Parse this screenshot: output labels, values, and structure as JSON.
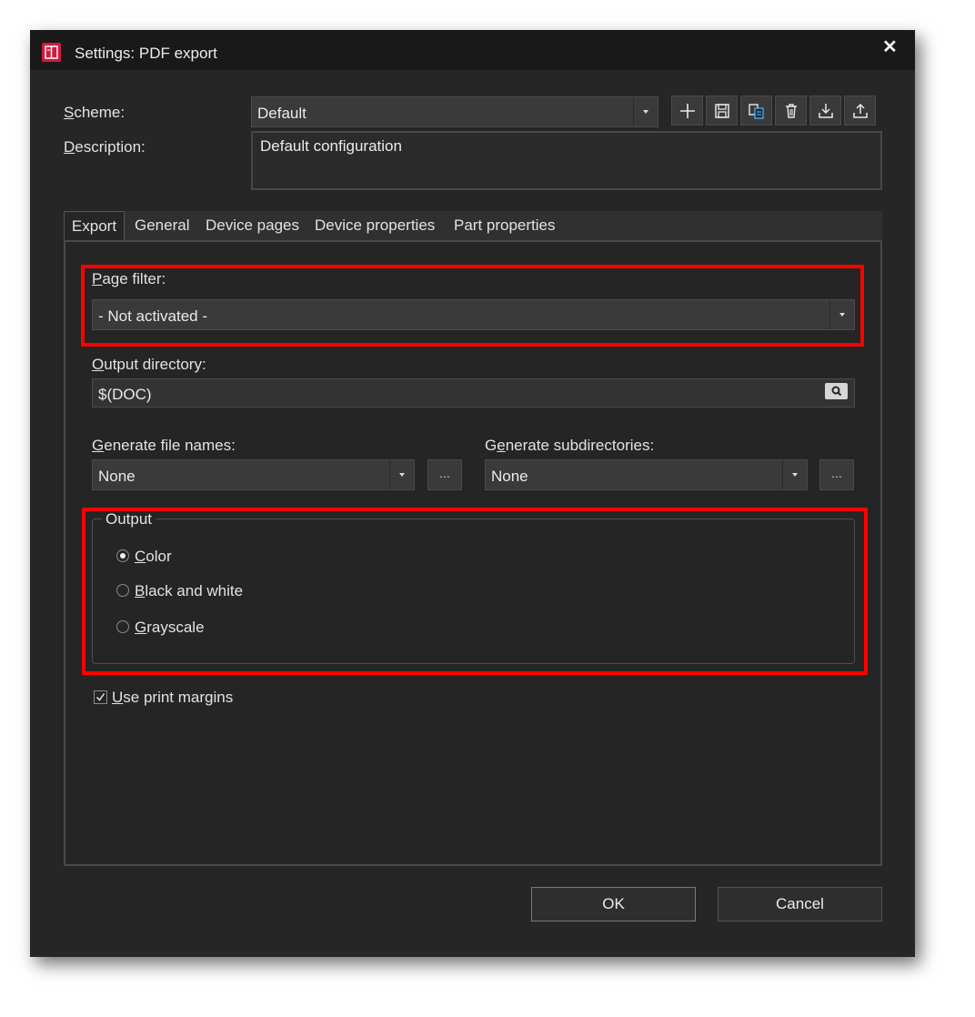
{
  "window": {
    "title": "Settings: PDF export",
    "close_glyph": "✕"
  },
  "scheme": {
    "label": "Scheme:",
    "value": "Default",
    "toolbar_icons": [
      "add-icon",
      "save-icon",
      "copy-icon",
      "delete-icon",
      "import-icon",
      "export-icon"
    ]
  },
  "description": {
    "label": "Description:",
    "value": "Default configuration"
  },
  "tabs": [
    {
      "label": "Export",
      "active": true
    },
    {
      "label": "General"
    },
    {
      "label": "Device pages"
    },
    {
      "label": "Device properties"
    },
    {
      "label": "Part properties"
    }
  ],
  "page_filter": {
    "label": "Page filter:",
    "value": "- Not activated -"
  },
  "output_directory": {
    "label": "Output directory:",
    "value": "$(DOC)"
  },
  "generate_file_names": {
    "label": "Generate file names:",
    "value": "None",
    "more_label": "..."
  },
  "generate_subdirectories": {
    "label": "Generate subdirectories:",
    "value": "None",
    "more_label": "..."
  },
  "output": {
    "title": "Output",
    "options": [
      {
        "label": "Color",
        "selected": true
      },
      {
        "label": "Black and white",
        "selected": false
      },
      {
        "label": "Grayscale",
        "selected": false
      }
    ]
  },
  "use_print_margins": {
    "label": "Use print margins",
    "checked": true
  },
  "buttons": {
    "ok": "OK",
    "cancel": "Cancel"
  },
  "colors": {
    "highlight": "#ff0000",
    "app_icon": "#d4183f",
    "background": "#262626"
  }
}
